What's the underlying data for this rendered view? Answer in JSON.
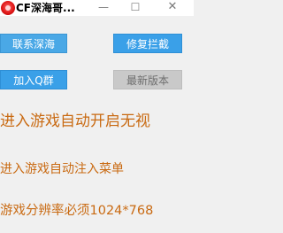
{
  "window": {
    "title": "CF深海哥...",
    "minimize_glyph": "—",
    "maximize_glyph": "☐",
    "close_glyph": "✕",
    "icon": "app-logo-icon"
  },
  "buttons": {
    "contact": "联系深海",
    "repair": "修复拦截",
    "join_group": "加入Q群",
    "latest_version": "最新版本"
  },
  "notices": {
    "line1": "进入游戏自动开启无视",
    "line2": "进入游戏自动注入菜单",
    "line3": "游戏分辨率必须1024*768"
  },
  "colors": {
    "button_blue": "#4aa8e6",
    "button_disabled": "#c9c9c9",
    "notice_text": "#c96a12",
    "background": "#f0f0f0"
  }
}
